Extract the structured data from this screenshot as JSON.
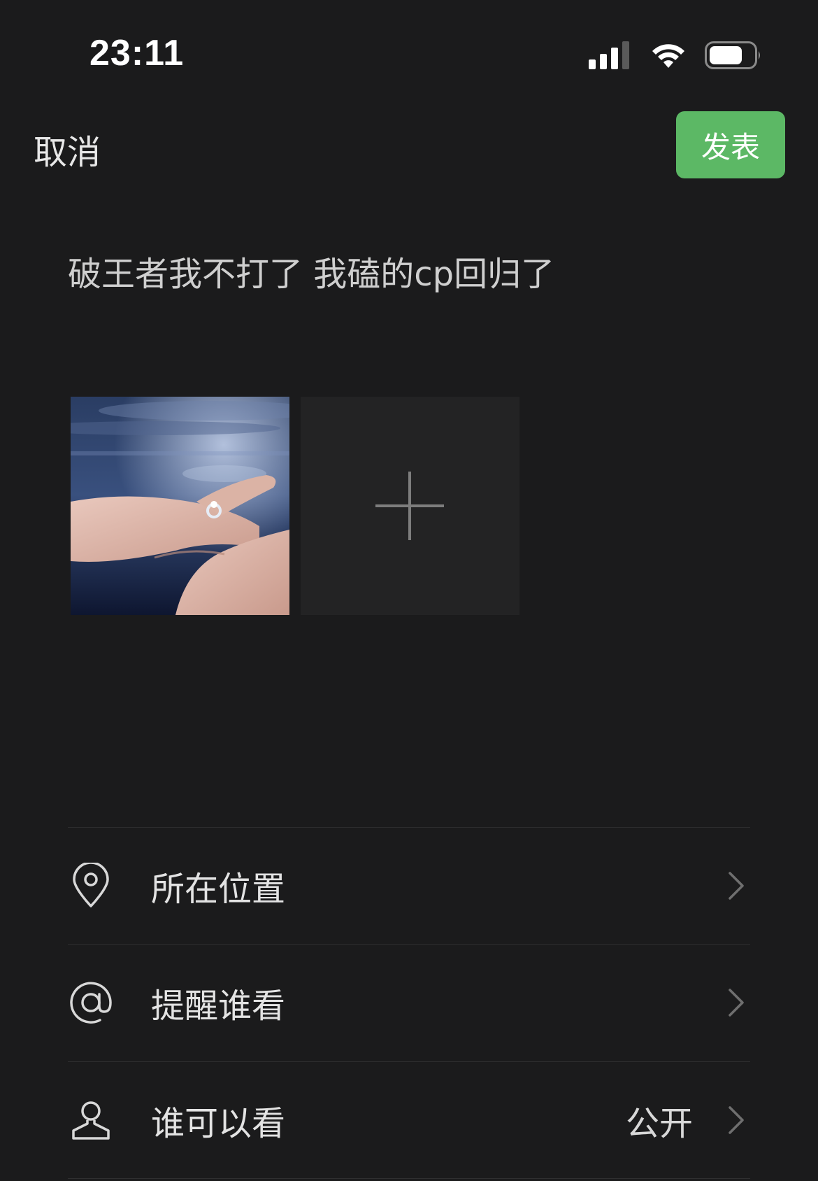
{
  "status_bar": {
    "time": "23:11"
  },
  "nav": {
    "cancel_label": "取消",
    "publish_label": "发表",
    "publish_color": "#5cb865"
  },
  "post": {
    "text": "破王者我不打了 我磕的cp回归了"
  },
  "media": {
    "photo_icon": "photo-thumbnail",
    "add_icon": "plus-icon"
  },
  "options": [
    {
      "label": "所在位置",
      "icon": "location-pin-icon",
      "value": ""
    },
    {
      "label": "提醒谁看",
      "icon": "at-sign-icon",
      "value": ""
    },
    {
      "label": "谁可以看",
      "icon": "person-icon",
      "value": "公开"
    }
  ]
}
